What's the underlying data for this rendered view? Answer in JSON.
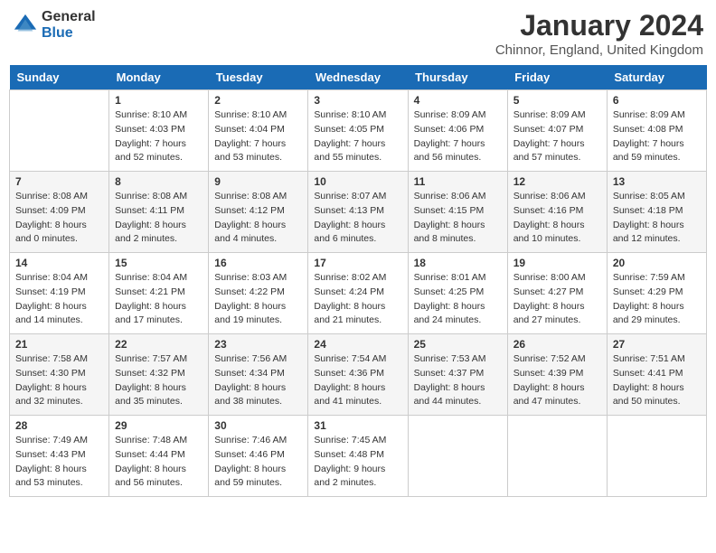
{
  "header": {
    "logo_general": "General",
    "logo_blue": "Blue",
    "month_title": "January 2024",
    "location": "Chinnor, England, United Kingdom"
  },
  "weekdays": [
    "Sunday",
    "Monday",
    "Tuesday",
    "Wednesday",
    "Thursday",
    "Friday",
    "Saturday"
  ],
  "weeks": [
    [
      {
        "day": "",
        "sunrise": "",
        "sunset": "",
        "daylight": ""
      },
      {
        "day": "1",
        "sunrise": "Sunrise: 8:10 AM",
        "sunset": "Sunset: 4:03 PM",
        "daylight": "Daylight: 7 hours and 52 minutes."
      },
      {
        "day": "2",
        "sunrise": "Sunrise: 8:10 AM",
        "sunset": "Sunset: 4:04 PM",
        "daylight": "Daylight: 7 hours and 53 minutes."
      },
      {
        "day": "3",
        "sunrise": "Sunrise: 8:10 AM",
        "sunset": "Sunset: 4:05 PM",
        "daylight": "Daylight: 7 hours and 55 minutes."
      },
      {
        "day": "4",
        "sunrise": "Sunrise: 8:09 AM",
        "sunset": "Sunset: 4:06 PM",
        "daylight": "Daylight: 7 hours and 56 minutes."
      },
      {
        "day": "5",
        "sunrise": "Sunrise: 8:09 AM",
        "sunset": "Sunset: 4:07 PM",
        "daylight": "Daylight: 7 hours and 57 minutes."
      },
      {
        "day": "6",
        "sunrise": "Sunrise: 8:09 AM",
        "sunset": "Sunset: 4:08 PM",
        "daylight": "Daylight: 7 hours and 59 minutes."
      }
    ],
    [
      {
        "day": "7",
        "sunrise": "Sunrise: 8:08 AM",
        "sunset": "Sunset: 4:09 PM",
        "daylight": "Daylight: 8 hours and 0 minutes."
      },
      {
        "day": "8",
        "sunrise": "Sunrise: 8:08 AM",
        "sunset": "Sunset: 4:11 PM",
        "daylight": "Daylight: 8 hours and 2 minutes."
      },
      {
        "day": "9",
        "sunrise": "Sunrise: 8:08 AM",
        "sunset": "Sunset: 4:12 PM",
        "daylight": "Daylight: 8 hours and 4 minutes."
      },
      {
        "day": "10",
        "sunrise": "Sunrise: 8:07 AM",
        "sunset": "Sunset: 4:13 PM",
        "daylight": "Daylight: 8 hours and 6 minutes."
      },
      {
        "day": "11",
        "sunrise": "Sunrise: 8:06 AM",
        "sunset": "Sunset: 4:15 PM",
        "daylight": "Daylight: 8 hours and 8 minutes."
      },
      {
        "day": "12",
        "sunrise": "Sunrise: 8:06 AM",
        "sunset": "Sunset: 4:16 PM",
        "daylight": "Daylight: 8 hours and 10 minutes."
      },
      {
        "day": "13",
        "sunrise": "Sunrise: 8:05 AM",
        "sunset": "Sunset: 4:18 PM",
        "daylight": "Daylight: 8 hours and 12 minutes."
      }
    ],
    [
      {
        "day": "14",
        "sunrise": "Sunrise: 8:04 AM",
        "sunset": "Sunset: 4:19 PM",
        "daylight": "Daylight: 8 hours and 14 minutes."
      },
      {
        "day": "15",
        "sunrise": "Sunrise: 8:04 AM",
        "sunset": "Sunset: 4:21 PM",
        "daylight": "Daylight: 8 hours and 17 minutes."
      },
      {
        "day": "16",
        "sunrise": "Sunrise: 8:03 AM",
        "sunset": "Sunset: 4:22 PM",
        "daylight": "Daylight: 8 hours and 19 minutes."
      },
      {
        "day": "17",
        "sunrise": "Sunrise: 8:02 AM",
        "sunset": "Sunset: 4:24 PM",
        "daylight": "Daylight: 8 hours and 21 minutes."
      },
      {
        "day": "18",
        "sunrise": "Sunrise: 8:01 AM",
        "sunset": "Sunset: 4:25 PM",
        "daylight": "Daylight: 8 hours and 24 minutes."
      },
      {
        "day": "19",
        "sunrise": "Sunrise: 8:00 AM",
        "sunset": "Sunset: 4:27 PM",
        "daylight": "Daylight: 8 hours and 27 minutes."
      },
      {
        "day": "20",
        "sunrise": "Sunrise: 7:59 AM",
        "sunset": "Sunset: 4:29 PM",
        "daylight": "Daylight: 8 hours and 29 minutes."
      }
    ],
    [
      {
        "day": "21",
        "sunrise": "Sunrise: 7:58 AM",
        "sunset": "Sunset: 4:30 PM",
        "daylight": "Daylight: 8 hours and 32 minutes."
      },
      {
        "day": "22",
        "sunrise": "Sunrise: 7:57 AM",
        "sunset": "Sunset: 4:32 PM",
        "daylight": "Daylight: 8 hours and 35 minutes."
      },
      {
        "day": "23",
        "sunrise": "Sunrise: 7:56 AM",
        "sunset": "Sunset: 4:34 PM",
        "daylight": "Daylight: 8 hours and 38 minutes."
      },
      {
        "day": "24",
        "sunrise": "Sunrise: 7:54 AM",
        "sunset": "Sunset: 4:36 PM",
        "daylight": "Daylight: 8 hours and 41 minutes."
      },
      {
        "day": "25",
        "sunrise": "Sunrise: 7:53 AM",
        "sunset": "Sunset: 4:37 PM",
        "daylight": "Daylight: 8 hours and 44 minutes."
      },
      {
        "day": "26",
        "sunrise": "Sunrise: 7:52 AM",
        "sunset": "Sunset: 4:39 PM",
        "daylight": "Daylight: 8 hours and 47 minutes."
      },
      {
        "day": "27",
        "sunrise": "Sunrise: 7:51 AM",
        "sunset": "Sunset: 4:41 PM",
        "daylight": "Daylight: 8 hours and 50 minutes."
      }
    ],
    [
      {
        "day": "28",
        "sunrise": "Sunrise: 7:49 AM",
        "sunset": "Sunset: 4:43 PM",
        "daylight": "Daylight: 8 hours and 53 minutes."
      },
      {
        "day": "29",
        "sunrise": "Sunrise: 7:48 AM",
        "sunset": "Sunset: 4:44 PM",
        "daylight": "Daylight: 8 hours and 56 minutes."
      },
      {
        "day": "30",
        "sunrise": "Sunrise: 7:46 AM",
        "sunset": "Sunset: 4:46 PM",
        "daylight": "Daylight: 8 hours and 59 minutes."
      },
      {
        "day": "31",
        "sunrise": "Sunrise: 7:45 AM",
        "sunset": "Sunset: 4:48 PM",
        "daylight": "Daylight: 9 hours and 2 minutes."
      },
      {
        "day": "",
        "sunrise": "",
        "sunset": "",
        "daylight": ""
      },
      {
        "day": "",
        "sunrise": "",
        "sunset": "",
        "daylight": ""
      },
      {
        "day": "",
        "sunrise": "",
        "sunset": "",
        "daylight": ""
      }
    ]
  ]
}
